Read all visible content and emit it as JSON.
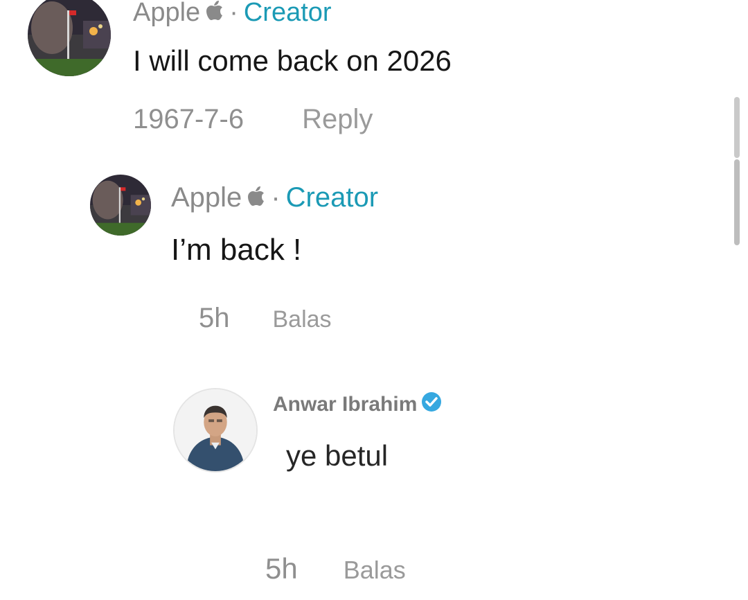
{
  "comments": [
    {
      "username": "Apple",
      "separator": "·",
      "badge": "Creator",
      "text": "I will come back on 2026",
      "time": "1967-7-6",
      "reply_label": "Reply"
    },
    {
      "username": "Apple",
      "separator": "·",
      "badge": "Creator",
      "text": "I’m back !",
      "time": "5h",
      "reply_label": "Balas"
    },
    {
      "username": "Anwar Ibrahim",
      "text": "ye betul",
      "time": "5h",
      "reply_label": "Balas"
    }
  ],
  "colors": {
    "creator_accent": "#1b9ab5",
    "verified": "#36a8e0",
    "muted_text": "#8a8a8a"
  },
  "icons": [
    "apple-logo-icon",
    "verified-badge-icon"
  ]
}
